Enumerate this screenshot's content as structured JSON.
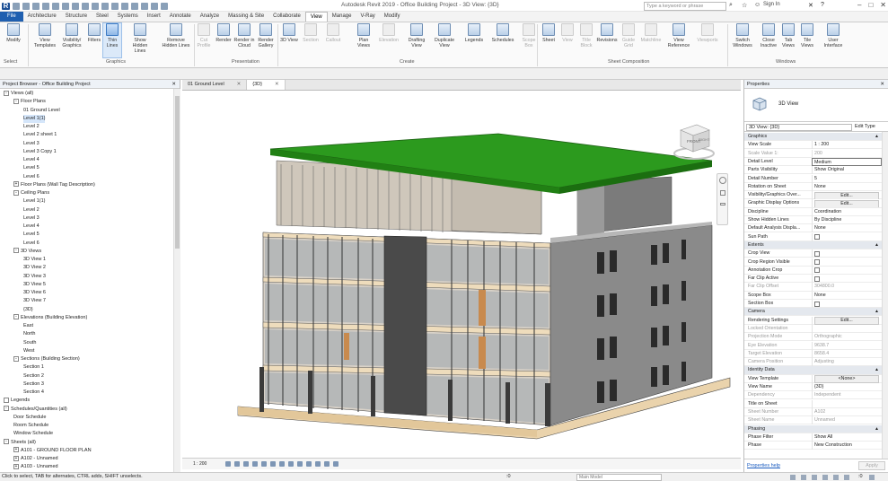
{
  "titlebar": {
    "title": "Autodesk Revit 2019 - Office Building Project - 3D View: {3D}",
    "search_placeholder": "Type a keyword or phrase",
    "sign_in": "Sign In"
  },
  "tabs": [
    "File",
    "Architecture",
    "Structure",
    "Steel",
    "Systems",
    "Insert",
    "Annotate",
    "Analyze",
    "Massing & Site",
    "Collaborate",
    "View",
    "Manage",
    "V-Ray",
    "Modify"
  ],
  "active_tab": "View",
  "ribbon": {
    "modify": "Modify",
    "select": "Select",
    "graphics": {
      "label": "Graphics",
      "buttons": [
        "View Templates",
        "Visibility/ Graphics",
        "Filters",
        "Thin Lines",
        "Show Hidden Lines",
        "Remove Hidden Lines"
      ]
    },
    "presentation": {
      "label": "Presentation",
      "buttons": [
        "Cut Profile",
        "Render",
        "Render in Cloud",
        "Render Gallery"
      ]
    },
    "create": {
      "label": "Create",
      "buttons": [
        "3D View",
        "Section",
        "Callout",
        "Plan Views",
        "Elevation",
        "Drafting View",
        "Duplicate View",
        "Legends",
        "Schedules",
        "Scope Box"
      ]
    },
    "sheet": {
      "label": "Sheet Composition",
      "buttons": [
        "Sheet",
        "View",
        "Title Block",
        "Revisions",
        "Guide Grid",
        "Matchline",
        "View Reference",
        "Viewports"
      ]
    },
    "windows": {
      "label": "Windows",
      "buttons": [
        "Switch Windows",
        "Close Inactive",
        "Tab Views",
        "Tile Views",
        "User Interface"
      ]
    }
  },
  "browser": {
    "title": "Project Browser - Office Building Project",
    "items": [
      {
        "t": "Views (all)",
        "l": 0,
        "e": "-"
      },
      {
        "t": "Floor Plans",
        "l": 1,
        "e": "-"
      },
      {
        "t": "01 Ground Level",
        "l": 2
      },
      {
        "t": "Level 1(1)",
        "l": 2,
        "sel": true
      },
      {
        "t": "Level 2",
        "l": 2
      },
      {
        "t": "Level 2 sheet 1",
        "l": 2
      },
      {
        "t": "Level 3",
        "l": 2
      },
      {
        "t": "Level 3 Copy 1",
        "l": 2
      },
      {
        "t": "Level 4",
        "l": 2
      },
      {
        "t": "Level 5",
        "l": 2
      },
      {
        "t": "Level 6",
        "l": 2
      },
      {
        "t": "Floor Plans (Wall Tag Description)",
        "l": 1,
        "e": "+"
      },
      {
        "t": "Ceiling Plans",
        "l": 1,
        "e": "-"
      },
      {
        "t": "Level 1(1)",
        "l": 2
      },
      {
        "t": "Level 2",
        "l": 2
      },
      {
        "t": "Level 3",
        "l": 2
      },
      {
        "t": "Level 4",
        "l": 2
      },
      {
        "t": "Level 5",
        "l": 2
      },
      {
        "t": "Level 6",
        "l": 2
      },
      {
        "t": "3D Views",
        "l": 1,
        "e": "-"
      },
      {
        "t": "3D View 1",
        "l": 2
      },
      {
        "t": "3D View 2",
        "l": 2
      },
      {
        "t": "3D View 3",
        "l": 2
      },
      {
        "t": "3D View 5",
        "l": 2
      },
      {
        "t": "3D View 6",
        "l": 2
      },
      {
        "t": "3D View 7",
        "l": 2
      },
      {
        "t": "{3D}",
        "l": 2
      },
      {
        "t": "Elevations (Building Elevation)",
        "l": 1,
        "e": "-"
      },
      {
        "t": "East",
        "l": 2
      },
      {
        "t": "North",
        "l": 2
      },
      {
        "t": "South",
        "l": 2
      },
      {
        "t": "West",
        "l": 2
      },
      {
        "t": "Sections (Building Section)",
        "l": 1,
        "e": "-"
      },
      {
        "t": "Section 1",
        "l": 2
      },
      {
        "t": "Section 2",
        "l": 2
      },
      {
        "t": "Section 3",
        "l": 2
      },
      {
        "t": "Section 4",
        "l": 2
      },
      {
        "t": "Legends",
        "l": 0,
        "e": " "
      },
      {
        "t": "Schedules/Quantities (all)",
        "l": 0,
        "e": "-"
      },
      {
        "t": "Door Schedule",
        "l": 1
      },
      {
        "t": "Room Schedule",
        "l": 1
      },
      {
        "t": "Window Schedule",
        "l": 1
      },
      {
        "t": "Sheets (all)",
        "l": 0,
        "e": "-"
      },
      {
        "t": "A101 - GROUND FLOOR PLAN",
        "l": 1,
        "e": "+"
      },
      {
        "t": "A102 - Unnamed",
        "l": 1,
        "e": "+"
      },
      {
        "t": "A103 - Unnamed",
        "l": 1,
        "e": "+"
      }
    ]
  },
  "view_tabs": [
    "01 Ground Level",
    "{3D}"
  ],
  "viewcube": {
    "front": "FRONT",
    "right": "RIGHT"
  },
  "view_control": {
    "scale": "1 : 200"
  },
  "properties": {
    "title": "Properties",
    "type_name": "3D View",
    "selector": "3D View: {3D}",
    "edit_type": "Edit Type",
    "rows": [
      {
        "g": "Graphics"
      },
      {
        "k": "View Scale",
        "v": "1 : 200"
      },
      {
        "k": "Scale Value  1:",
        "v": "200",
        "dim": true
      },
      {
        "k": "Detail Level",
        "v": "Medium",
        "box": true
      },
      {
        "k": "Parts Visibility",
        "v": "Show Original"
      },
      {
        "k": "Detail Number",
        "v": "5"
      },
      {
        "k": "Rotation on Sheet",
        "v": "None"
      },
      {
        "k": "Visibility/Graphics Over...",
        "v": "Edit...",
        "btn": true
      },
      {
        "k": "Graphic Display Options",
        "v": "Edit...",
        "btn": true
      },
      {
        "k": "Discipline",
        "v": "Coordination"
      },
      {
        "k": "Show Hidden Lines",
        "v": "By Discipline"
      },
      {
        "k": "Default Analysis Displa...",
        "v": "None"
      },
      {
        "k": "Sun Path",
        "v": "",
        "chk": true
      },
      {
        "g": "Extents"
      },
      {
        "k": "Crop View",
        "v": "",
        "chk": true
      },
      {
        "k": "Crop Region Visible",
        "v": "",
        "chk": true
      },
      {
        "k": "Annotation Crop",
        "v": "",
        "chk": true
      },
      {
        "k": "Far Clip Active",
        "v": "",
        "chk": true
      },
      {
        "k": "Far Clip Offset",
        "v": "304800.0",
        "dim": true
      },
      {
        "k": "Scope Box",
        "v": "None"
      },
      {
        "k": "Section Box",
        "v": "",
        "chk": true
      },
      {
        "g": "Camera"
      },
      {
        "k": "Rendering Settings",
        "v": "Edit...",
        "btn": true
      },
      {
        "k": "Locked Orientation",
        "v": "",
        "dim": true
      },
      {
        "k": "Projection Mode",
        "v": "Orthographic",
        "dim": true
      },
      {
        "k": "Eye Elevation",
        "v": "9638.7",
        "dim": true
      },
      {
        "k": "Target Elevation",
        "v": "8658.4",
        "dim": true
      },
      {
        "k": "Camera Position",
        "v": "Adjusting",
        "dim": true
      },
      {
        "g": "Identity Data"
      },
      {
        "k": "View Template",
        "v": "<None>",
        "btn": true
      },
      {
        "k": "View Name",
        "v": "{3D}"
      },
      {
        "k": "Dependency",
        "v": "Independent",
        "dim": true
      },
      {
        "k": "Title on Sheet",
        "v": ""
      },
      {
        "k": "Sheet Number",
        "v": "A102",
        "dim": true
      },
      {
        "k": "Sheet Name",
        "v": "Unnamed",
        "dim": true
      },
      {
        "g": "Phasing"
      },
      {
        "k": "Phase Filter",
        "v": "Show All"
      },
      {
        "k": "Phase",
        "v": "New Construction"
      }
    ],
    "help": "Properties help",
    "apply": "Apply"
  },
  "status": {
    "message": "Click to select, TAB for alternates, CTRL adds, SHIFT unselects.",
    "main_model": "Main Model",
    "zero": ":0"
  }
}
